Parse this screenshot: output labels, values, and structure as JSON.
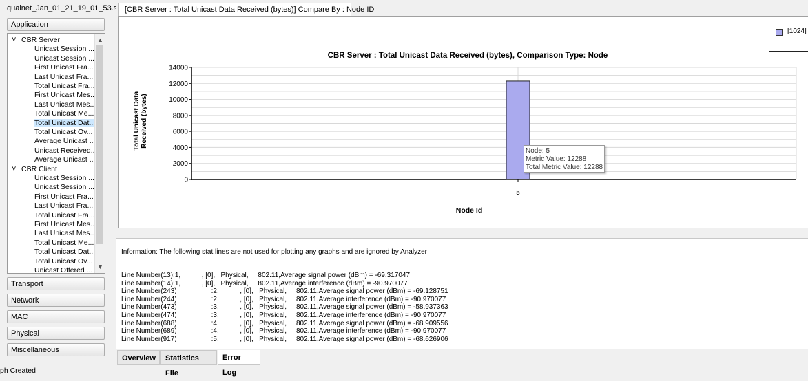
{
  "window": {
    "file_tab": "qualnet_Jan_01_21_19_01_53.s...",
    "chart_tab": "[CBR Server :  Total Unicast Data Received (bytes)] Compare By : Node ID"
  },
  "sidebar": {
    "application_label": "Application",
    "tree": [
      {
        "type": "group",
        "label": "CBR Server"
      },
      {
        "type": "item",
        "label": "Unicast Session ..."
      },
      {
        "type": "item",
        "label": "Unicast Session ..."
      },
      {
        "type": "item",
        "label": "First Unicast Fra..."
      },
      {
        "type": "item",
        "label": "Last Unicast Fra..."
      },
      {
        "type": "item",
        "label": "Total Unicast Fra..."
      },
      {
        "type": "item",
        "label": "First Unicast Mes..."
      },
      {
        "type": "item",
        "label": "Last Unicast Mes..."
      },
      {
        "type": "item",
        "label": "Total Unicast Me..."
      },
      {
        "type": "item",
        "label": "Total Unicast Dat...",
        "selected": true
      },
      {
        "type": "item",
        "label": "Total Unicast Ov..."
      },
      {
        "type": "item",
        "label": "Average Unicast ..."
      },
      {
        "type": "item",
        "label": "Unicast Received..."
      },
      {
        "type": "item",
        "label": "Average Unicast ..."
      },
      {
        "type": "group",
        "label": "CBR Client"
      },
      {
        "type": "item",
        "label": "Unicast Session ..."
      },
      {
        "type": "item",
        "label": "Unicast Session ..."
      },
      {
        "type": "item",
        "label": "First Unicast Fra..."
      },
      {
        "type": "item",
        "label": "Last Unicast Fra..."
      },
      {
        "type": "item",
        "label": "Total Unicast Fra..."
      },
      {
        "type": "item",
        "label": "First Unicast Mes..."
      },
      {
        "type": "item",
        "label": "Last Unicast Mes..."
      },
      {
        "type": "item",
        "label": "Total Unicast Me..."
      },
      {
        "type": "item",
        "label": "Total Unicast Dat..."
      },
      {
        "type": "item",
        "label": "Total Unicast Ov..."
      },
      {
        "type": "item",
        "label": "Unicast Offered ..."
      }
    ],
    "categories": [
      "Transport",
      "Network",
      "MAC",
      "Physical",
      "Miscellaneous"
    ]
  },
  "chart_data": {
    "type": "bar",
    "title": "CBR Server :  Total Unicast Data Received (bytes), Comparison Type: Node",
    "xlabel": "Node Id",
    "ylabel": "Total Unicast Data Received (bytes)",
    "ylabel_lines": [
      "Total Unicast Data",
      "Received (bytes)"
    ],
    "categories": [
      "5"
    ],
    "series": [
      {
        "name": "[1024]",
        "values": [
          12288
        ],
        "color": "#aaaaee"
      }
    ],
    "ylim": [
      0,
      14000
    ],
    "yticks": [
      0,
      2000,
      4000,
      6000,
      8000,
      10000,
      12000,
      14000
    ],
    "grid": true,
    "legend": "top-right",
    "tooltip": [
      "Node: 5",
      "Metric Value: 12288",
      "Total Metric Value: 12288"
    ]
  },
  "info": {
    "header": "Information: The following stat lines are not used for plotting any graphs and are ignored by Analyzer",
    "lines": [
      "Line Number(13):1,           , [0],   Physical,     802.11,Average signal power (dBm) = -69.317047",
      "Line Number(14):1,           , [0],   Physical,     802.11,Average interference (dBm) = -90.970077",
      "Line Number(243)                  :2,           , [0],   Physical,     802.11,Average signal power (dBm) = -69.128751",
      "Line Number(244)                  :2,           , [0],   Physical,     802.11,Average interference (dBm) = -90.970077",
      "Line Number(473)                  :3,           , [0],   Physical,     802.11,Average signal power (dBm) = -58.937363",
      "Line Number(474)                  :3,           , [0],   Physical,     802.11,Average interference (dBm) = -90.970077",
      "Line Number(688)                  :4,           , [0],   Physical,     802.11,Average signal power (dBm) = -68.909556",
      "Line Number(689)                  :4,           , [0],   Physical,     802.11,Average interference (dBm) = -90.970077",
      "Line Number(917)                  :5,           , [0],   Physical,     802.11,Average signal power (dBm) = -68.626906"
    ]
  },
  "bottom_tabs": [
    "Overview",
    "Statistics File",
    "Error Log"
  ],
  "status": "ph Created"
}
